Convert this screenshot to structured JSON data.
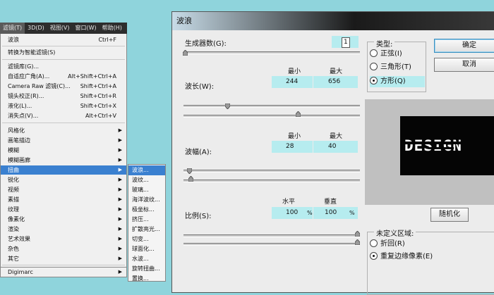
{
  "menubar": [
    {
      "label": "滤镜(T)",
      "active": true
    },
    {
      "label": "3D(D)"
    },
    {
      "label": "视图(V)"
    },
    {
      "label": "窗口(W)"
    },
    {
      "label": "帮助(H)"
    }
  ],
  "menu": {
    "items": [
      {
        "label": "波浪",
        "shortcut": "Ctrl+F"
      },
      {
        "label": "转换为智能滤镜(S)"
      },
      {
        "label": "滤镜库(G)..."
      },
      {
        "label": "自适应广角(A)...",
        "shortcut": "Alt+Shift+Ctrl+A"
      },
      {
        "label": "Camera Raw 滤镜(C)...",
        "shortcut": "Shift+Ctrl+A"
      },
      {
        "label": "镜头校正(R)...",
        "shortcut": "Shift+Ctrl+R"
      },
      {
        "label": "液化(L)...",
        "shortcut": "Shift+Ctrl+X"
      },
      {
        "label": "消失点(V)...",
        "shortcut": "Alt+Ctrl+V"
      },
      {
        "label": "风格化",
        "submenu": true
      },
      {
        "label": "画笔描边",
        "submenu": true
      },
      {
        "label": "模糊",
        "submenu": true
      },
      {
        "label": "模糊画廊",
        "submenu": true
      },
      {
        "label": "扭曲",
        "submenu": true,
        "highlighted": true
      },
      {
        "label": "锐化",
        "submenu": true
      },
      {
        "label": "视频",
        "submenu": true
      },
      {
        "label": "素描",
        "submenu": true
      },
      {
        "label": "纹理",
        "submenu": true
      },
      {
        "label": "像素化",
        "submenu": true
      },
      {
        "label": "渲染",
        "submenu": true
      },
      {
        "label": "艺术效果",
        "submenu": true
      },
      {
        "label": "杂色",
        "submenu": true
      },
      {
        "label": "其它",
        "submenu": true
      },
      {
        "label": "Digimarc",
        "submenu": true
      }
    ],
    "submenu": [
      {
        "label": "波浪...",
        "highlighted": true
      },
      {
        "label": "波纹..."
      },
      {
        "label": "玻璃..."
      },
      {
        "label": "海洋波纹..."
      },
      {
        "label": "极坐标..."
      },
      {
        "label": "挤压..."
      },
      {
        "label": "扩散亮光..."
      },
      {
        "label": "切变..."
      },
      {
        "label": "球面化..."
      },
      {
        "label": "水波..."
      },
      {
        "label": "旋转扭曲..."
      },
      {
        "label": "置换..."
      }
    ]
  },
  "dialog": {
    "title": "波浪",
    "generators_label": "生成器数(G):",
    "generators_value": "1",
    "wavelength_label": "波长(W):",
    "amplitude_label": "波幅(A):",
    "scale_label": "比例(S):",
    "min_header": "最小",
    "max_header": "最大",
    "horizontal_header": "水平",
    "vertical_header": "垂直",
    "wavelength_min": "244",
    "wavelength_max": "656",
    "amplitude_min": "28",
    "amplitude_max": "40",
    "scale_h": "100",
    "scale_v": "100",
    "percent": "%",
    "type_title": "类型:",
    "types": [
      {
        "label": "正弦(I)",
        "selected": false
      },
      {
        "label": "三角形(T)",
        "selected": false
      },
      {
        "label": "方形(Q)",
        "selected": true
      }
    ],
    "ok_label": "确定",
    "cancel_label": "取消",
    "randomize_label": "随机化",
    "undefined_title": "未定义区域:",
    "undefined_options": [
      {
        "label": "折回(R)",
        "selected": false
      },
      {
        "label": "重复边缘像素(E)",
        "selected": true
      }
    ],
    "preview_text": "DESIGN"
  },
  "colors": {
    "highlight": "#3a80d0",
    "field": "#b6ecef",
    "background": "#8fd4dc"
  }
}
